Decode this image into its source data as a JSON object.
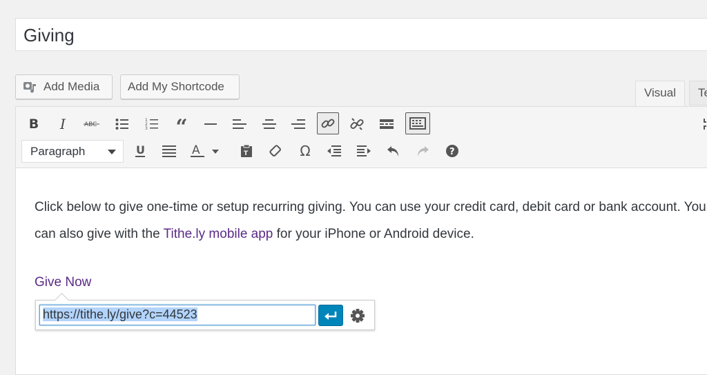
{
  "title": {
    "value": "Giving"
  },
  "buttons": {
    "add_media": "Add Media",
    "add_shortcode": "Add My Shortcode"
  },
  "tabs": {
    "visual": "Visual",
    "text": "Te"
  },
  "toolbar": {
    "format_select": "Paragraph",
    "row1": [
      "bold-icon",
      "italic-icon",
      "strikethrough-icon",
      "bullet-list-icon",
      "numbered-list-icon",
      "blockquote-icon",
      "horizontal-line-icon",
      "align-left-icon",
      "align-center-icon",
      "align-right-icon",
      "insert-link-icon",
      "unlink-icon",
      "read-more-icon",
      "toolbar-toggle-icon"
    ],
    "row2": [
      "underline-icon",
      "justify-icon",
      "text-color-icon",
      "paste-text-icon",
      "clear-formatting-icon",
      "special-character-icon",
      "outdent-icon",
      "indent-icon",
      "undo-icon",
      "redo-icon",
      "help-icon"
    ]
  },
  "content": {
    "paragraph_start": "Click below to give one-time or setup recurring giving. You can use your credit card, debit card or bank account. You can also give with the ",
    "paragraph_link": "Tithe.ly mobile app",
    "paragraph_end": " for your iPhone or Android device.",
    "give_link": "Give Now"
  },
  "link_popup": {
    "url": "https://tithe.ly/give?c=44523"
  },
  "colors": {
    "link": "#5b2a86",
    "apply_button": "#0085ba"
  }
}
